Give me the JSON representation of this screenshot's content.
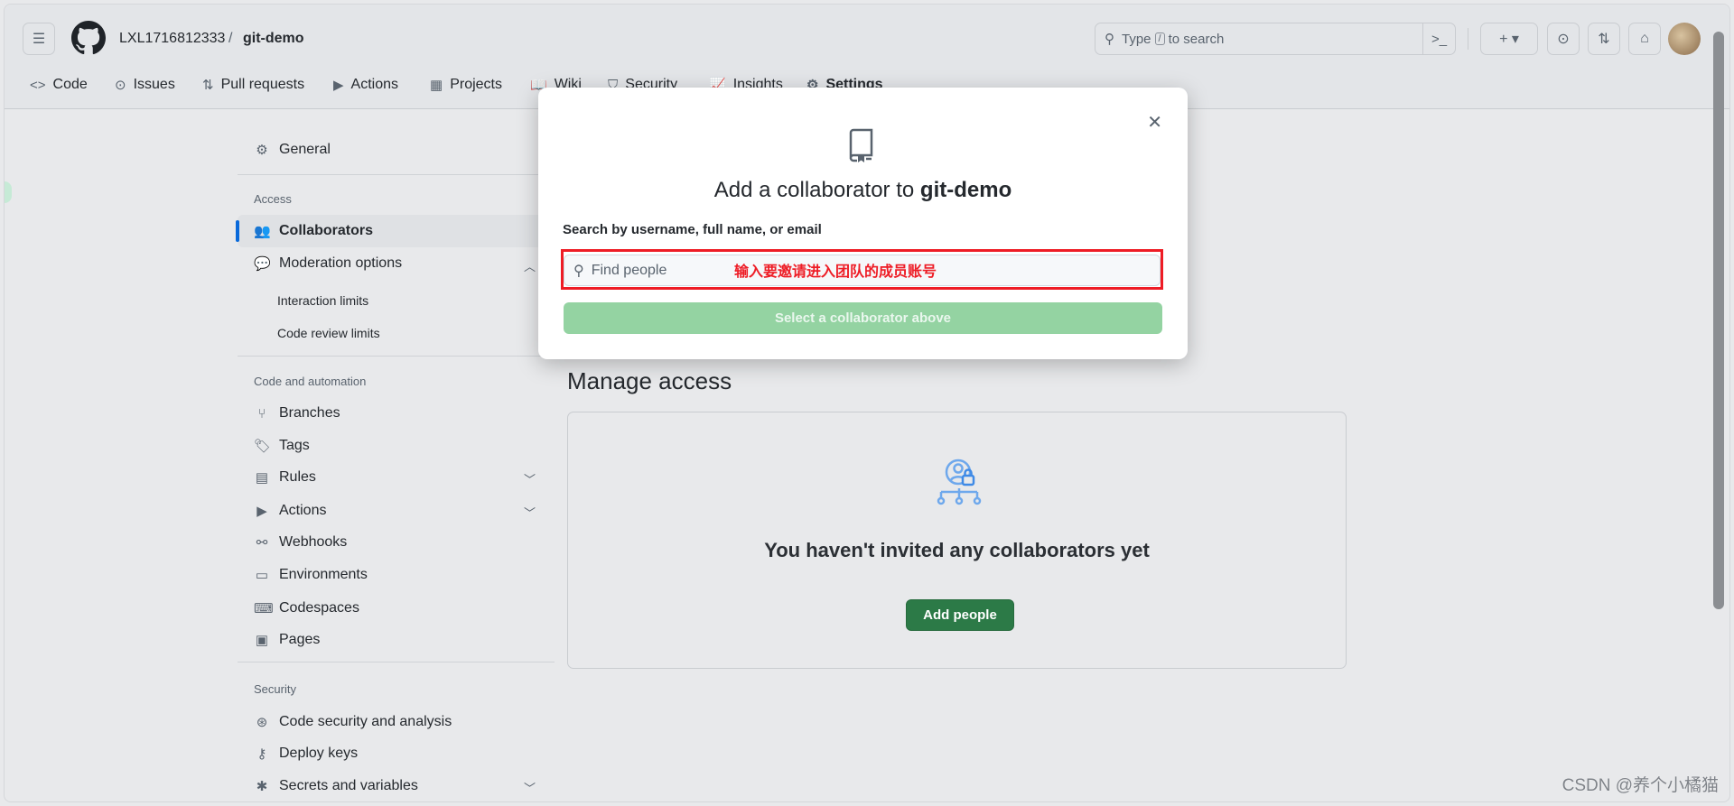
{
  "header": {
    "owner": "LXL1716812333",
    "separator": "/",
    "repo": "git-demo",
    "search": {
      "prefix": "Type",
      "key": "/",
      "suffix": "to search"
    }
  },
  "tabs": [
    {
      "label": "Code",
      "icon": "code-icon",
      "glyph": "<>"
    },
    {
      "label": "Issues",
      "icon": "issue-icon",
      "glyph": "⊙"
    },
    {
      "label": "Pull requests",
      "icon": "pull-request-icon",
      "glyph": "⇅"
    },
    {
      "label": "Actions",
      "icon": "play-icon",
      "glyph": "▶"
    },
    {
      "label": "Projects",
      "icon": "table-icon",
      "glyph": "▦"
    },
    {
      "label": "Wiki",
      "icon": "book-icon",
      "glyph": "📖"
    },
    {
      "label": "Security",
      "icon": "shield-icon",
      "glyph": "⛉"
    },
    {
      "label": "Insights",
      "icon": "graph-icon",
      "glyph": "📈"
    },
    {
      "label": "Settings",
      "icon": "gear-icon",
      "glyph": "⚙"
    }
  ],
  "sidebar": {
    "general": "General",
    "access_heading": "Access",
    "collaborators": "Collaborators",
    "moderation": "Moderation options",
    "interaction_limits": "Interaction limits",
    "code_review_limits": "Code review limits",
    "code_heading": "Code and automation",
    "branches": "Branches",
    "tags": "Tags",
    "rules": "Rules",
    "actions": "Actions",
    "webhooks": "Webhooks",
    "environments": "Environments",
    "codespaces": "Codespaces",
    "pages": "Pages",
    "security_heading": "Security",
    "code_security": "Code security and analysis",
    "deploy_keys": "Deploy keys",
    "secrets": "Secrets and variables"
  },
  "main": {
    "title": "Manage access",
    "empty_text": "You haven't invited any collaborators yet",
    "add_people": "Add people"
  },
  "modal": {
    "title_prefix": "Add a collaborator to",
    "title_repo": "git-demo",
    "label": "Search by username, full name, or email",
    "placeholder": "Find people",
    "annotation": "输入要邀请进入团队的成员账号",
    "submit": "Select a collaborator above"
  },
  "watermark": "CSDN @养个小橘猫",
  "colors": {
    "accent": "#0969da",
    "primary_button": "#2c7a47",
    "disabled_button": "#94d3a2",
    "annotation_red": "#ee1c25"
  }
}
